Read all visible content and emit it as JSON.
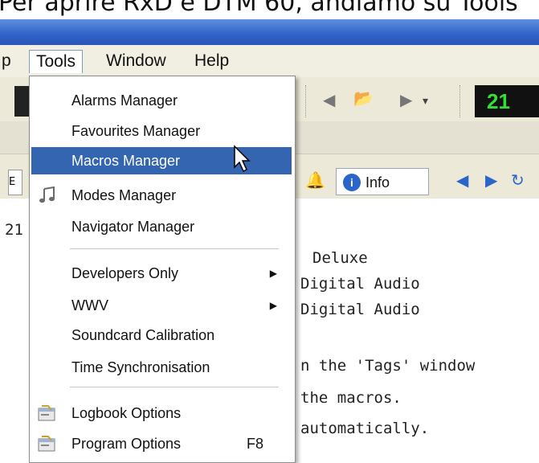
{
  "caption": {
    "text": "Per aprire RxD e DTM 60, andiamo su Tools"
  },
  "menubar": {
    "items": [
      {
        "label": "p",
        "open": false
      },
      {
        "label": "Tools",
        "open": true
      },
      {
        "label": "Window",
        "open": false
      },
      {
        "label": "Help",
        "open": false
      }
    ]
  },
  "toolbar": {
    "clock": "21",
    "info_label": "Info",
    "left_stub": "E"
  },
  "dropdown": {
    "items": [
      {
        "label": "Alarms Manager"
      },
      {
        "label": "Favourites Manager"
      },
      {
        "label": "Macros Manager",
        "highlighted": true
      },
      {
        "label": "Modes Manager",
        "icon": "music-note-icon"
      },
      {
        "label": "Navigator Manager"
      },
      {
        "label": "Developers Only",
        "submenu": true
      },
      {
        "label": "WWV",
        "submenu": true
      },
      {
        "label": "Soundcard Calibration"
      },
      {
        "label": "Time Synchronisation"
      },
      {
        "label": "Logbook Options",
        "icon": "options-dialog-icon"
      },
      {
        "label": "Program Options",
        "icon": "options-dialog-icon",
        "shortcut": "F8"
      }
    ]
  },
  "editor": {
    "lines": [
      "21",
      "Deluxe",
      "Digital Audio",
      "Digital Audio",
      "n the 'Tags' window",
      "the macros.",
      " automatically."
    ]
  },
  "colors": {
    "highlight": "#3465b1",
    "titlebar": "#2f62c7",
    "clock_text": "#32e032"
  }
}
